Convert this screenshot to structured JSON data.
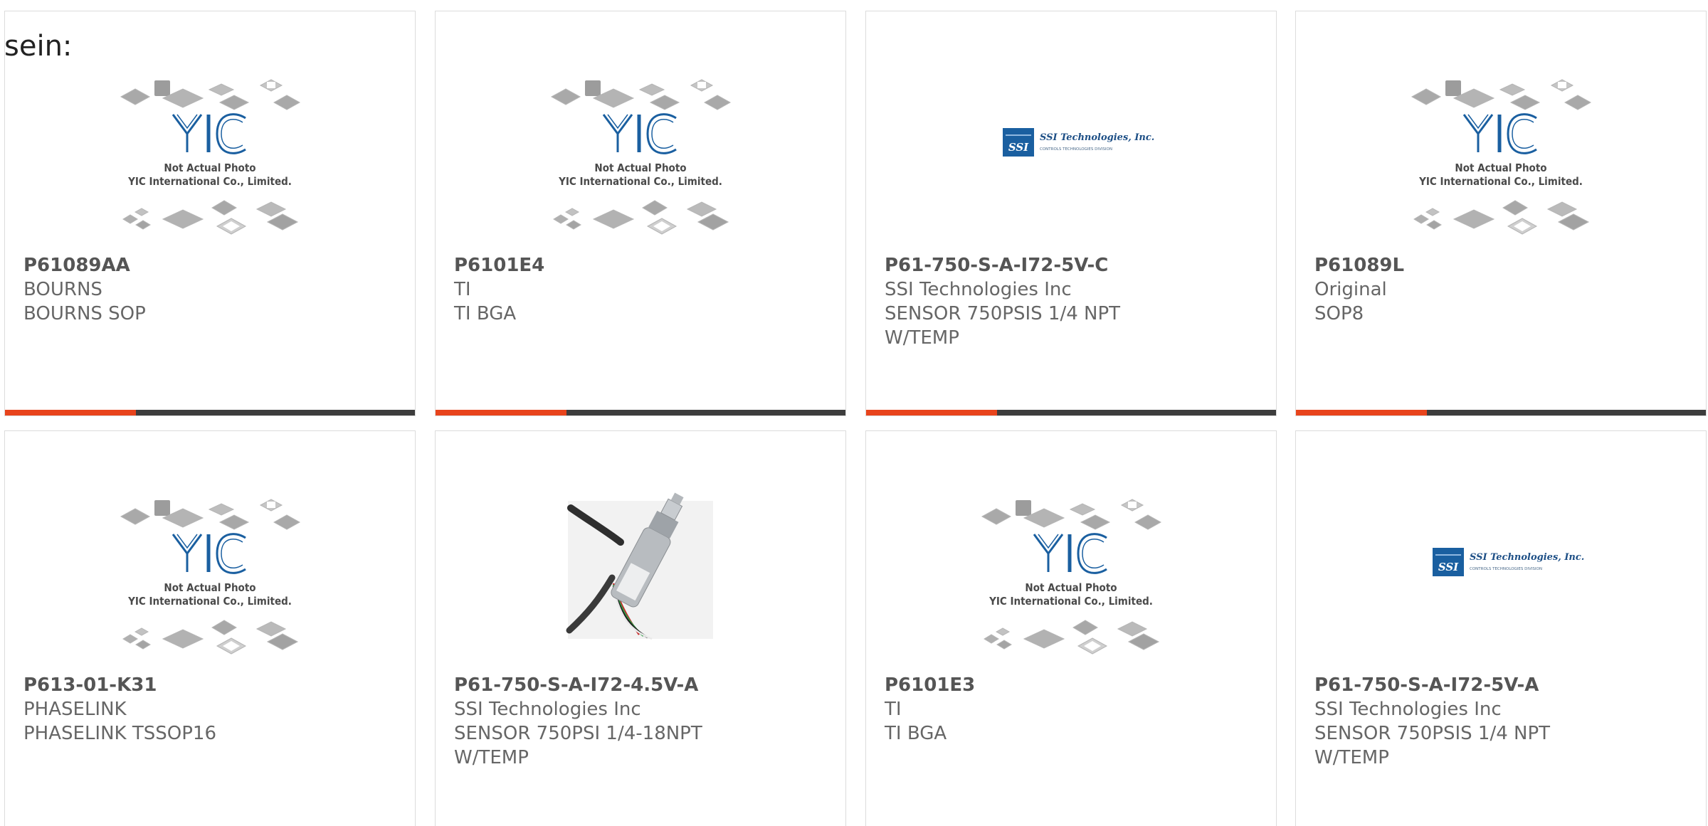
{
  "page": {
    "top_fragment": "sein:"
  },
  "placeholder_image": {
    "caption_line1": "Not Actual Photo",
    "caption_line2": "YIC International Co., Limited.",
    "logo_text": "YIC"
  },
  "ssi_logo": {
    "name": "SSI Technologies, Inc.",
    "tagline": "CONTROLS TECHNOLOGIES DIVISION",
    "mark": "SSI"
  },
  "colors": {
    "accent": "#e8441c",
    "bar_dark": "#3d3d3d",
    "logo_blue": "#1a5fa0"
  },
  "products": [
    {
      "part_number": "P61089AA",
      "manufacturer": "BOURNS",
      "description": "BOURNS SOP",
      "image": "yic-placeholder",
      "progress": 0.32
    },
    {
      "part_number": "P6101E4",
      "manufacturer": "TI",
      "description": "TI BGA",
      "image": "yic-placeholder",
      "progress": 0.32
    },
    {
      "part_number": "P61-750-S-A-I72-5V-C",
      "manufacturer": "SSI Technologies Inc",
      "description": "SENSOR 750PSIS 1/4 NPT",
      "description2": "W/TEMP",
      "image": "ssi-logo",
      "progress": 0.32
    },
    {
      "part_number": "P61089L",
      "manufacturer": "Original",
      "description": "SOP8",
      "image": "yic-placeholder",
      "progress": 0.32
    },
    {
      "part_number": "P613-01-K31",
      "manufacturer": "PHASELINK",
      "description": "PHASELINK TSSOP16",
      "image": "yic-placeholder"
    },
    {
      "part_number": "P61-750-S-A-I72-4.5V-A",
      "manufacturer": "SSI Technologies Inc",
      "description": "SENSOR 750PSI 1/4-18NPT",
      "description2": "W/TEMP",
      "image": "sensor-photo"
    },
    {
      "part_number": "P6101E3",
      "manufacturer": "TI",
      "description": "TI BGA",
      "image": "yic-placeholder"
    },
    {
      "part_number": "P61-750-S-A-I72-5V-A",
      "manufacturer": "SSI Technologies Inc",
      "description": "SENSOR 750PSIS 1/4 NPT",
      "description2": "W/TEMP",
      "image": "ssi-logo"
    }
  ]
}
